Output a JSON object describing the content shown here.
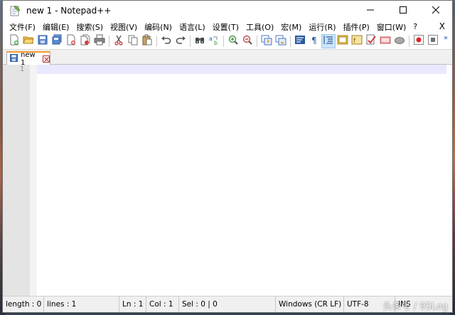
{
  "window": {
    "title": "new 1 - Notepad++",
    "minimize": "—",
    "maximize": "☐",
    "close": "✕"
  },
  "menu": {
    "items": [
      "文件(F)",
      "编辑(E)",
      "搜索(S)",
      "视图(V)",
      "编码(N)",
      "语言(L)",
      "设置(T)",
      "工具(O)",
      "宏(M)",
      "运行(R)",
      "插件(P)",
      "窗口(W)",
      "?"
    ],
    "close_label": "X"
  },
  "toolbar": {
    "more_label": "»",
    "icons": [
      "new-file-icon",
      "open-file-icon",
      "save-icon",
      "save-all-icon",
      "close-icon",
      "close-all-icon",
      "print-icon",
      "cut-icon",
      "copy-icon",
      "paste-icon",
      "undo-icon",
      "redo-icon",
      "find-icon",
      "replace-icon",
      "zoom-in-icon",
      "zoom-out-icon",
      "sync-vertical-icon",
      "sync-horizontal-icon",
      "word-wrap-icon",
      "show-all-chars-icon",
      "indent-guide-icon",
      "doc-map-icon",
      "function-list-icon",
      "folder-workspace-icon",
      "monitoring-icon",
      "record-macro-icon",
      "stop-record-icon"
    ]
  },
  "tabs": [
    {
      "label": "new 1"
    }
  ],
  "editor": {
    "line_numbers": [
      "1"
    ]
  },
  "status": {
    "length": "length : 0",
    "lines": "lines : 1",
    "ln": "Ln : 1",
    "col": "Col : 1",
    "sel": "Sel : 0 | 0",
    "eol": "Windows (CR LF)",
    "encoding": "UTF-8",
    "mode": "INS"
  },
  "watermark": "头条号 / 9SLog",
  "colors": {
    "tab_accent": "#fa9a28",
    "current_line": "#e8e8ff",
    "gutter": "#e4e4e4"
  }
}
